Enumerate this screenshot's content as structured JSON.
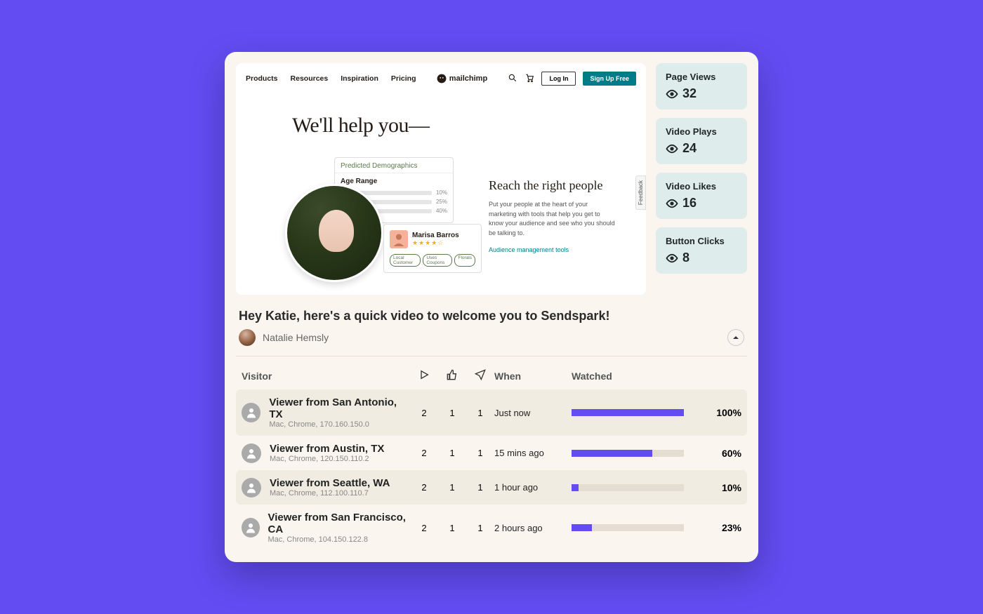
{
  "preview": {
    "nav": {
      "items": [
        "Products",
        "Resources",
        "Inspiration",
        "Pricing"
      ],
      "brand": "mailchimp",
      "login": "Log In",
      "signup": "Sign Up Free"
    },
    "headline": "We'll help you—",
    "demographics": {
      "title": "Predicted Demographics",
      "section": "Age Range",
      "rows": [
        "10%",
        "25%",
        "40%"
      ]
    },
    "profile": {
      "name": "Marisa Barros",
      "stars": "★★★★☆",
      "chips": [
        "Local Customer",
        "Uses Coupons",
        "Florals"
      ]
    },
    "rhs": {
      "heading": "Reach the right people",
      "body": "Put your people at the heart of your marketing with tools that help you get to know your audience and see who you should be talking to.",
      "link": "Audience management tools"
    },
    "feedback": "Feedback"
  },
  "stats": [
    {
      "label": "Page Views",
      "value": "32"
    },
    {
      "label": "Video Plays",
      "value": "24"
    },
    {
      "label": "Video Likes",
      "value": "16"
    },
    {
      "label": "Button Clicks",
      "value": "8"
    }
  ],
  "greeting": "Hey Katie, here's a quick video to welcome you to Sendspark!",
  "author": "Natalie Hemsly",
  "table": {
    "headers": {
      "visitor": "Visitor",
      "when": "When",
      "watched": "Watched"
    },
    "rows": [
      {
        "name": "Viewer from San Antonio, TX",
        "meta": "Mac, Chrome, 170.160.150.0",
        "plays": "2",
        "likes": "1",
        "clicks": "1",
        "when": "Just now",
        "pct": "100%",
        "width": "100%"
      },
      {
        "name": "Viewer from Austin, TX",
        "meta": "Mac, Chrome, 120.150.110.2",
        "plays": "2",
        "likes": "1",
        "clicks": "1",
        "when": "15 mins ago",
        "pct": "60%",
        "width": "72%"
      },
      {
        "name": "Viewer from Seattle, WA",
        "meta": "Mac, Chrome, 112.100.110.7",
        "plays": "2",
        "likes": "1",
        "clicks": "1",
        "when": "1 hour ago",
        "pct": "10%",
        "width": "6%"
      },
      {
        "name": "Viewer from San Francisco, CA",
        "meta": "Mac, Chrome, 104.150.122.8",
        "plays": "2",
        "likes": "1",
        "clicks": "1",
        "when": "2 hours ago",
        "pct": "23%",
        "width": "18%"
      }
    ]
  }
}
